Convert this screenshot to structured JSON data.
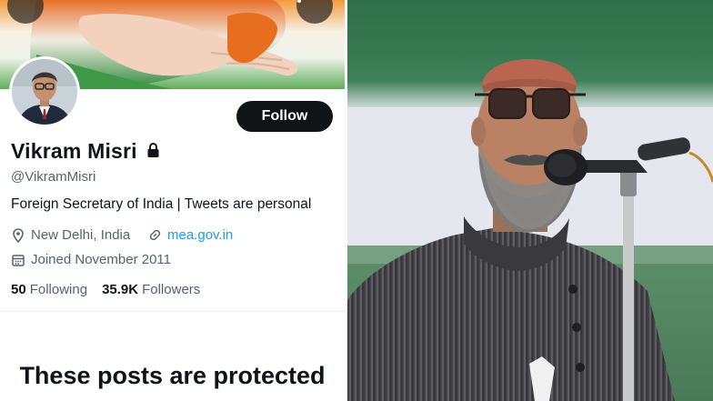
{
  "profile": {
    "display_name": "Vikram Misri",
    "handle": "@VikramMisri",
    "bio": "Foreign Secretary of India | Tweets are personal",
    "location": "New Delhi, India",
    "website": "mea.gov.in",
    "joined": "Joined November 2011",
    "following_count": "50",
    "following_label": "Following",
    "followers_count": "35.9K",
    "followers_label": "Followers",
    "follow_button": "Follow",
    "protected_message": "These posts are protected"
  },
  "icons": {
    "back": "back-arrow-icon",
    "more": "more-vertical-icon",
    "lock": "lock-icon",
    "location": "location-pin-icon",
    "link": "link-icon",
    "calendar": "calendar-icon"
  },
  "colors": {
    "follow_button_bg": "#0f1419",
    "link": "#1d9bf0",
    "secondary_text": "#536471"
  }
}
